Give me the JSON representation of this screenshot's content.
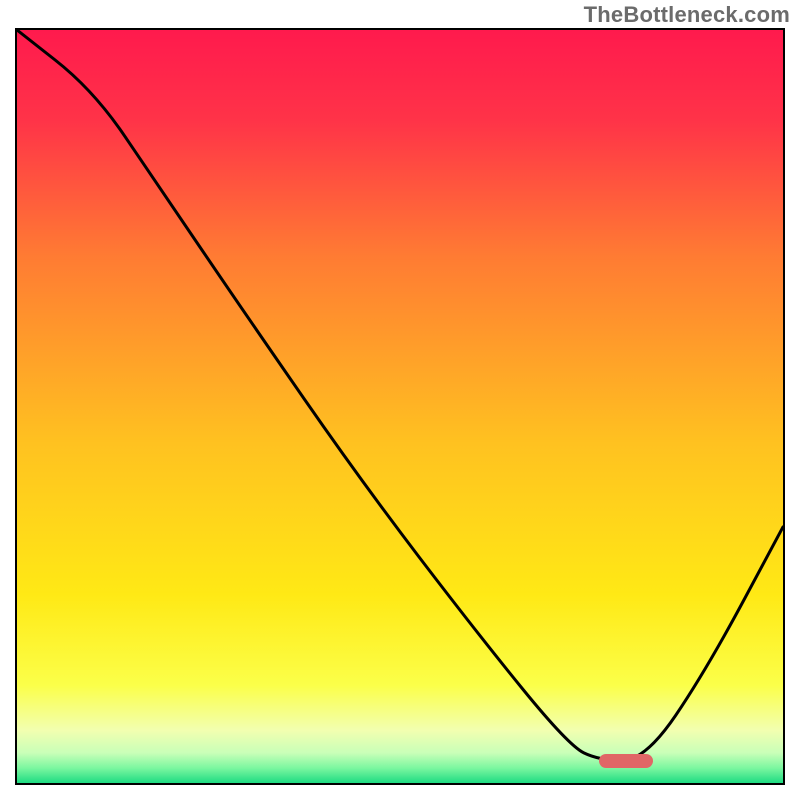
{
  "watermark": "TheBottleneck.com",
  "colors": {
    "gradient_stops": [
      {
        "offset": "0%",
        "color": "#ff1a4d"
      },
      {
        "offset": "12%",
        "color": "#ff3348"
      },
      {
        "offset": "30%",
        "color": "#ff7b33"
      },
      {
        "offset": "55%",
        "color": "#ffc220"
      },
      {
        "offset": "75%",
        "color": "#ffe915"
      },
      {
        "offset": "87%",
        "color": "#fbff49"
      },
      {
        "offset": "93%",
        "color": "#f2ffb0"
      },
      {
        "offset": "96%",
        "color": "#c9ffb8"
      },
      {
        "offset": "98%",
        "color": "#7cf7a0"
      },
      {
        "offset": "100%",
        "color": "#1edb82"
      }
    ],
    "curve_stroke": "#000000",
    "marker_fill": "#e06666"
  },
  "chart_data": {
    "type": "line",
    "title": "",
    "xlabel": "",
    "ylabel": "",
    "xlim": [
      0,
      100
    ],
    "ylim": [
      0,
      100
    ],
    "series": [
      {
        "name": "bottleneck_curve",
        "x": [
          0,
          10,
          18,
          30,
          45,
          60,
          72,
          76,
          82,
          90,
          100
        ],
        "y": [
          100,
          92,
          80,
          62,
          40,
          20,
          5,
          3,
          3,
          15,
          34
        ]
      }
    ],
    "annotations": [
      {
        "name": "optimum_zone",
        "type": "bar_marker",
        "x_start": 76,
        "x_end": 83,
        "y": 3,
        "color": "#e06666"
      }
    ]
  }
}
